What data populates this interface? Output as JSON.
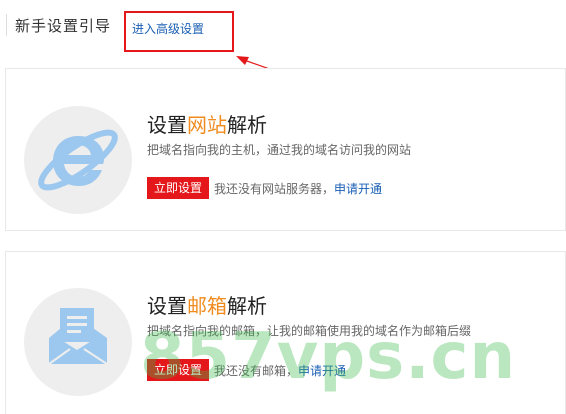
{
  "header": {
    "title": "新手设置引导",
    "advanced_link": "进入高级设置"
  },
  "cards": {
    "web": {
      "title_prefix": "设置",
      "title_accent": "网站",
      "title_suffix": "解析",
      "description": "把域名指向我的主机，通过我的域名访问我的网站",
      "button": "立即设置",
      "note": "我还没有网站服务器，",
      "link": "申请开通",
      "icon": "internet-explorer-icon"
    },
    "mail": {
      "title_prefix": "设置",
      "title_accent": "邮箱",
      "title_suffix": "解析",
      "description": "把域名指向我的邮箱，让我的邮箱使用我的域名作为邮箱后缀",
      "button": "立即设置",
      "note": "我还没有邮箱，",
      "link": "申请开通",
      "icon": "envelope-icon"
    }
  },
  "watermark": "857vps.cn",
  "colors": {
    "accent": "#f08c1f",
    "button": "#e4181b",
    "link": "#1a5fb4",
    "highlight": "#e4181b"
  }
}
